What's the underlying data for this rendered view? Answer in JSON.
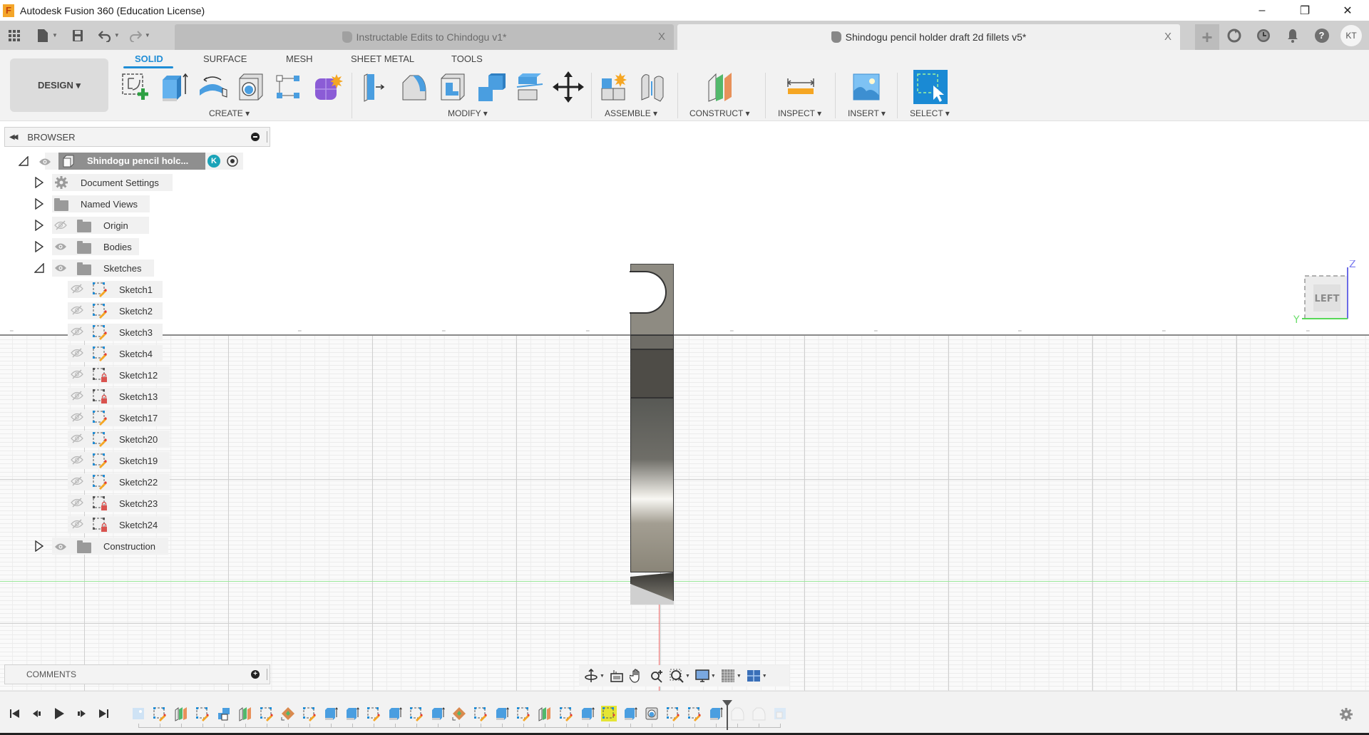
{
  "window": {
    "app_icon": "F",
    "title": "Autodesk Fusion 360 (Education License)",
    "controls": {
      "minimize": "–",
      "restore": "❐",
      "close": "✕"
    }
  },
  "tabbar": {
    "quick_access": [
      {
        "name": "data-panel-grid-icon",
        "glyph": "▦"
      },
      {
        "name": "file-menu-icon",
        "glyph": "▮"
      },
      {
        "name": "save-icon",
        "glyph": "💾"
      },
      {
        "name": "undo-icon",
        "glyph": "↶"
      },
      {
        "name": "redo-icon",
        "glyph": "↷"
      }
    ],
    "tabs": [
      {
        "label": "Instructable Edits to Chindogu v1*",
        "active": false,
        "close": "X"
      },
      {
        "label": "Shindogu pencil holder draft 2d fillets v5*",
        "active": true,
        "close": "X"
      }
    ],
    "new_tab": "+",
    "right_icons": [
      {
        "name": "extensions-icon",
        "glyph": "⟳"
      },
      {
        "name": "job-status-icon",
        "glyph": "◷"
      },
      {
        "name": "notifications-icon",
        "glyph": "🔔"
      },
      {
        "name": "help-icon",
        "glyph": "?"
      }
    ],
    "user_initials": "KT"
  },
  "ribbon": {
    "workspace": "DESIGN ▾",
    "tabs": [
      "SOLID",
      "SURFACE",
      "MESH",
      "SHEET METAL",
      "TOOLS"
    ],
    "active_tab": "SOLID",
    "groups": [
      {
        "label": "CREATE ▾",
        "tools": [
          "create-sketch",
          "extrude",
          "revolve",
          "hole",
          "pattern",
          "create-form"
        ]
      },
      {
        "label": "MODIFY ▾",
        "tools": [
          "press-pull",
          "fillet",
          "shell",
          "combine",
          "split-body",
          "move"
        ]
      },
      {
        "label": "ASSEMBLE ▾",
        "tools": [
          "new-component",
          "joint"
        ]
      },
      {
        "label": "CONSTRUCT ▾",
        "tools": [
          "offset-plane"
        ]
      },
      {
        "label": "INSPECT ▾",
        "tools": [
          "measure"
        ]
      },
      {
        "label": "INSERT ▾",
        "tools": [
          "insert-image"
        ]
      },
      {
        "label": "SELECT ▾",
        "tools": [
          "select"
        ]
      }
    ]
  },
  "browser": {
    "title": "BROWSER",
    "root": {
      "label": "Shindogu pencil holc...",
      "badge": "K"
    },
    "items": [
      {
        "label": "Document Settings",
        "icon": "gear",
        "visible": null,
        "expanded": false
      },
      {
        "label": "Named Views",
        "icon": "folder",
        "visible": null,
        "expanded": false
      },
      {
        "label": "Origin",
        "icon": "folder",
        "visible": false,
        "expanded": false
      },
      {
        "label": "Bodies",
        "icon": "folder",
        "visible": true,
        "expanded": false
      },
      {
        "label": "Sketches",
        "icon": "folder",
        "visible": true,
        "expanded": true
      }
    ],
    "sketches": [
      {
        "label": "Sketch1",
        "locked": false
      },
      {
        "label": "Sketch2",
        "locked": false
      },
      {
        "label": "Sketch3",
        "locked": false
      },
      {
        "label": "Sketch4",
        "locked": false
      },
      {
        "label": "Sketch12",
        "locked": true
      },
      {
        "label": "Sketch13",
        "locked": true
      },
      {
        "label": "Sketch17",
        "locked": false
      },
      {
        "label": "Sketch20",
        "locked": false
      },
      {
        "label": "Sketch19",
        "locked": false
      },
      {
        "label": "Sketch22",
        "locked": false
      },
      {
        "label": "Sketch23",
        "locked": true
      },
      {
        "label": "Sketch24",
        "locked": true
      }
    ],
    "construction": {
      "label": "Construction",
      "visible": true,
      "expanded": false
    }
  },
  "viewcube": {
    "face": "LEFT",
    "axis_z": "Z",
    "axis_y": "Y"
  },
  "comments": {
    "title": "COMMENTS"
  },
  "nav_toolbar": [
    "orbit",
    "look-at",
    "pan",
    "zoom",
    "fit",
    "display-settings",
    "grid-settings",
    "viewports"
  ],
  "timeline": {
    "controls": [
      "go-to-start",
      "step-back",
      "play",
      "step-forward",
      "go-to-end"
    ],
    "features": [
      "canvas",
      "sketch",
      "plane",
      "sketch",
      "combine",
      "plane",
      "sketch",
      "decal",
      "sketch",
      "extrude",
      "extrude",
      "sketch",
      "extrude",
      "sketch",
      "extrude",
      "decal",
      "sketch",
      "extrude",
      "sketch",
      "plane",
      "sketch",
      "extrude",
      "sketch-selected",
      "extrude",
      "hole",
      "sketch",
      "sketch",
      "extrude",
      "fillet-suppressed",
      "fillet-suppressed",
      "shell-suppressed"
    ],
    "highlighted_index": 22,
    "marker_after_index": 27
  },
  "colors": {
    "accent": "#1f8dd6",
    "highlight": "#e5e535",
    "lock": "#d9534f"
  }
}
